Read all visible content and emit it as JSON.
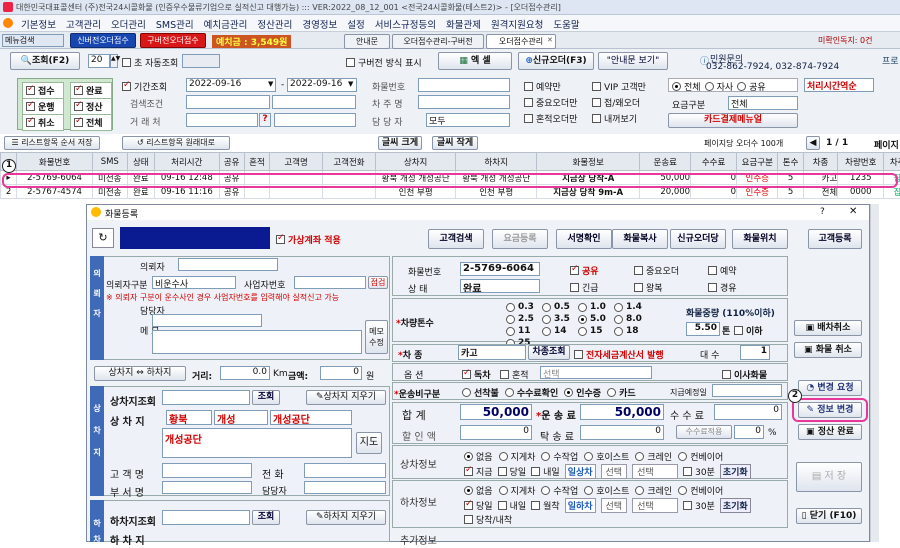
{
  "window": {
    "title": "대한민국대표콜센터 (주)전국24시콜화물 (인증우수물류기업으로 실적신고 대행가능) :::   VER:2022_08_12_001  <전국24시콜화물(테스트2)> - [오더접수관리]"
  },
  "menu": [
    "기본정보",
    "고객관리",
    "오더관리",
    "SMS관리",
    "예치금관리",
    "정산관리",
    "경영정보",
    "설정",
    "서비스규정등의",
    "화물관제",
    "원격지원요청",
    "도움말"
  ],
  "toolbar": {
    "menu_search": "메뉴검색",
    "btn_receive": "신버전오더접수",
    "btn_old": "구버전오더접수",
    "deposit": "예치금 : 3,549원",
    "tabs": [
      "안내문",
      "오더접수관리-구버전",
      "오더접수관리"
    ],
    "unread": "미확인독지: 0건"
  },
  "search": {
    "btn_search": "조회(F2)",
    "page_size": "20",
    "auto_search": "초 자동조회",
    "old_display": "구버전 방식 표시",
    "btn_excel": "엑 셀",
    "btn_new_order": "신규오더(F3)",
    "btn_notice": "\"안내문 보기\"",
    "complaint_label": "민원문의",
    "complaint_phone": "032-862-7924, 032-874-7924",
    "program_label": "프로"
  },
  "filters": {
    "status": [
      {
        "label": "접수",
        "on": true
      },
      {
        "label": "완료",
        "on": true
      },
      {
        "label": "운행",
        "on": true
      },
      {
        "label": "정산",
        "on": true
      },
      {
        "label": "취소",
        "on": true
      },
      {
        "label": "전체",
        "on": true
      }
    ],
    "period_label": "기간조회",
    "date_from": "2022-09-16",
    "date_to": "2022-09-16",
    "cargo_no_label": "화물번호",
    "search_cond_label": "검색조건",
    "car_no_label": "차 주 명",
    "trade_label": "거 래 처",
    "manager_label": "담 당 자",
    "manager_val": "모두",
    "options": [
      "예약만",
      "VIP 고객만",
      "중요오더만",
      "접/왜오더",
      "혼적오더만",
      "내꺼보기"
    ],
    "type_radios": [
      "전체",
      "자사",
      "공유"
    ],
    "process_order": "처리시간역순",
    "fare_label": "요금구분",
    "fare_val": "전체",
    "card_btn": "카드결제메뉴얼"
  },
  "listbar": {
    "save_order": "리스트항목 순서 저장",
    "restore": "리스트항목 원래대로",
    "font_big": "글씨 크게",
    "font_small": "글씨 작게",
    "page_info": "페이지당 오더수 100개",
    "page": "1  /  1",
    "page_move": "페이지"
  },
  "grid": {
    "headers": [
      "",
      "화물번호",
      "SMS",
      "상태",
      "처리시간",
      "공유",
      "혼적",
      "고객명",
      "고객전화",
      "상차지",
      "하차지",
      "화물정보",
      "운송료",
      "수수료",
      "요금구분",
      "톤수",
      "차종",
      "차량번호",
      "차주"
    ],
    "rows": [
      [
        "",
        "2-5769-6064",
        "미전송",
        "완료",
        "09-16 12:48",
        "공유",
        "",
        "",
        "",
        "황북 개성 개성공단",
        "황북 개성 개성공단",
        "지금상 당착-A",
        "50,000",
        "0",
        "인수증",
        "5",
        "카고",
        "1235",
        "잡"
      ],
      [
        "2",
        "2-5767-4574",
        "미전송",
        "완료",
        "09-16 11:16",
        "공유",
        "",
        "",
        "",
        "인천 부평",
        "인천 부평",
        "지금상 당착 9m-A",
        "20,000",
        "0",
        "인수증",
        "5",
        "전체",
        "0000",
        "잡"
      ]
    ]
  },
  "dialog": {
    "title": "화물등록",
    "fake_acc": "가상계좌 적용",
    "btns_top": [
      "고객검색",
      "요금등록",
      "서명확인",
      "화물복사",
      "신규오더당",
      "화물위치",
      "고객등록"
    ],
    "client": {
      "label": "의뢰자",
      "cond_label": "의뢰자구분",
      "cond_val": "비운수사",
      "biz_label": "사업자번호",
      "check_btn": "점검",
      "warn": "※ 의뢰자 구분이 운수사인 경우 사업자번호를 입력해야 실적신고 가능",
      "manager": "담당자",
      "memo": "메 모",
      "memo_btn": "메모\n수정"
    },
    "route": {
      "swap": "상차지 ⇔ 하차지",
      "dist_label": "거리:",
      "dist_val": "0.0",
      "km": "Km",
      "amount_label": "금액:",
      "amount_val": "0",
      "won": "원"
    },
    "pickup": {
      "search_label": "상차지조회",
      "search_btn": "조회",
      "clear_btn": "상차지 지우기",
      "addr_label": "상 차 지",
      "addr1": "황북",
      "addr2": "개성",
      "addr3": "개성공단",
      "detail": "개성공단",
      "map_btn": "지도",
      "name_label": "고 객 명",
      "phone_label": "전 화",
      "dept_label": "부 서 명",
      "mgr_label": "담당자",
      "side": "상차지"
    },
    "drop": {
      "search_label": "하차지조회",
      "search_btn": "조회",
      "clear_btn": "하차지 지우기",
      "addr_label": "하 차 지",
      "side": "하차지"
    },
    "cargo": {
      "no_label": "화물번호",
      "no_val": "2-5769-6064",
      "share": "공유",
      "important": "중요오더",
      "reserve": "예약",
      "status_label": "상 태",
      "status_val": "완료",
      "urgent": "긴급",
      "round": "왕복",
      "mixed": "경유"
    },
    "tonnage": {
      "label": "차량톤수",
      "options": [
        "0.3",
        "0.5",
        "1.0",
        "1.4",
        "2.5",
        "3.5",
        "5.0",
        "8.0",
        "11",
        "14",
        "15",
        "18",
        "25"
      ],
      "weight_label": "화물중량 (110%이하)",
      "weight_val": "5.50",
      "ton": "톤",
      "under": "이하"
    },
    "vehicle": {
      "label": "차 종",
      "val": "카고",
      "btn": "차종조회",
      "tax": "전자세금계산서 발행",
      "count_label": "대 수",
      "count_val": "1"
    },
    "option": {
      "label": "옵 션",
      "solo": "독차",
      "mixed": "혼적",
      "select": "선택",
      "move": "이사화물"
    },
    "payment": {
      "label": "운송비구분",
      "opts": [
        "선착불",
        "수수료확인",
        "인수증",
        "카드"
      ],
      "designate": "지급예정일"
    },
    "totals": {
      "sum_label": "합 계",
      "sum_val": "50,000",
      "fare_label": "운 송 료",
      "fare_val": "50,000",
      "fee_label": "수 수 료",
      "fee_val": "0",
      "disc_label": "할 인 액",
      "disc_val": "0",
      "tak_label": "탁 송 료",
      "tak_val": "0",
      "fee_apply": "수수료적용",
      "pct": "0",
      "pct_unit": "%"
    },
    "pick_info": {
      "label": "상차정보",
      "methods": [
        "없음",
        "지게차",
        "수작업",
        "호이스트",
        "크레인",
        "컨베이어"
      ],
      "when": [
        "지금",
        "당일",
        "내일"
      ],
      "select_a": "일상차",
      "sel1": "선택",
      "sel2": "선택",
      "min30": "30분",
      "reset": "초기화"
    },
    "drop_info": {
      "label": "하차정보",
      "methods": [
        "없음",
        "지게차",
        "수작업",
        "호이스트",
        "크레인",
        "컨베이어"
      ],
      "when": [
        "당일",
        "내일",
        "월착"
      ],
      "select_a": "일하차",
      "sel1": "선택",
      "sel2": "선택",
      "min30": "30분",
      "reset": "초기화",
      "extra": "당착/내착"
    },
    "extra_label": "추가정보",
    "side_btns": {
      "dispatch_cancel": "배차취소",
      "cargo_cancel": "화물 취소",
      "change_req": "변경 요청",
      "info_change": "정보 변경",
      "settle_done": "정산 완료",
      "save": "저 장",
      "close": "닫기 (F10)"
    }
  },
  "callouts": [
    "1",
    "2"
  ]
}
